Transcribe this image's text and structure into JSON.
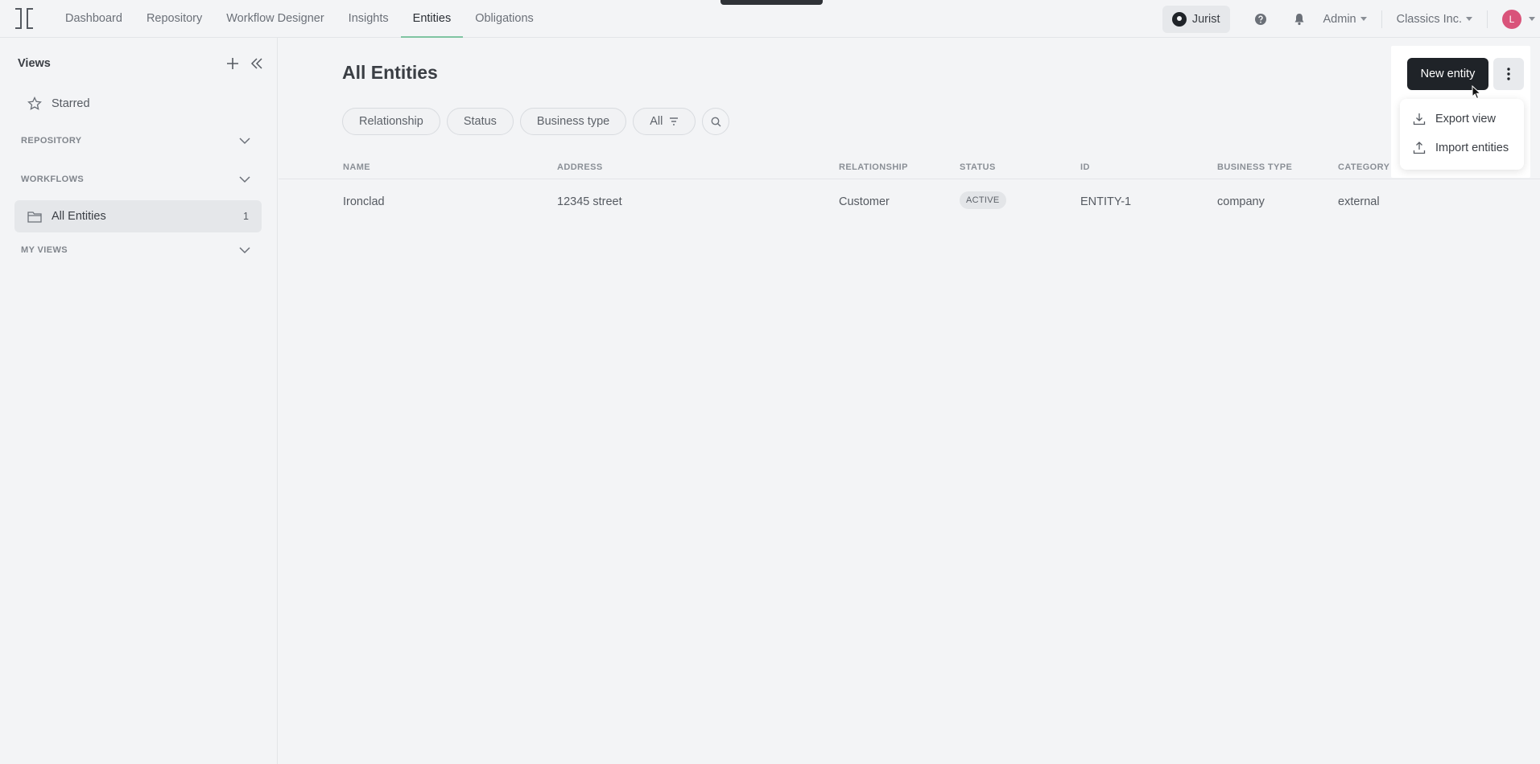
{
  "app": {
    "nav": [
      {
        "label": "Dashboard"
      },
      {
        "label": "Repository"
      },
      {
        "label": "Workflow Designer"
      },
      {
        "label": "Insights"
      },
      {
        "label": "Entities"
      },
      {
        "label": "Obligations"
      }
    ],
    "active_nav": "Entities",
    "jurist_label": "Jurist",
    "admin_label": "Admin",
    "org_label": "Classics Inc.",
    "avatar_initial": "L",
    "accent_color": "#7fc4a2",
    "avatar_color": "#d9537a"
  },
  "sidebar": {
    "title": "Views",
    "starred_label": "Starred",
    "sections": [
      {
        "label": "REPOSITORY"
      },
      {
        "label": "WORKFLOWS"
      },
      {
        "label": "MY VIEWS"
      }
    ],
    "active_item": {
      "label": "All Entities",
      "count": "1"
    }
  },
  "main": {
    "title": "All Entities",
    "filters": [
      {
        "label": "Relationship"
      },
      {
        "label": "Status"
      },
      {
        "label": "Business type"
      },
      {
        "label": "All"
      }
    ],
    "table": {
      "columns": [
        "NAME",
        "ADDRESS",
        "RELATIONSHIP",
        "STATUS",
        "ID",
        "BUSINESS TYPE",
        "CATEGORY"
      ],
      "rows": [
        {
          "name": "Ironclad",
          "address": "12345 street",
          "relationship": "Customer",
          "status": "ACTIVE",
          "id": "ENTITY-1",
          "business_type": "company",
          "category": "external"
        }
      ]
    }
  },
  "actions": {
    "new_entity_label": "New entity",
    "menu": [
      {
        "label": "Export view",
        "icon": "download-icon"
      },
      {
        "label": "Import entities",
        "icon": "upload-icon"
      }
    ]
  }
}
